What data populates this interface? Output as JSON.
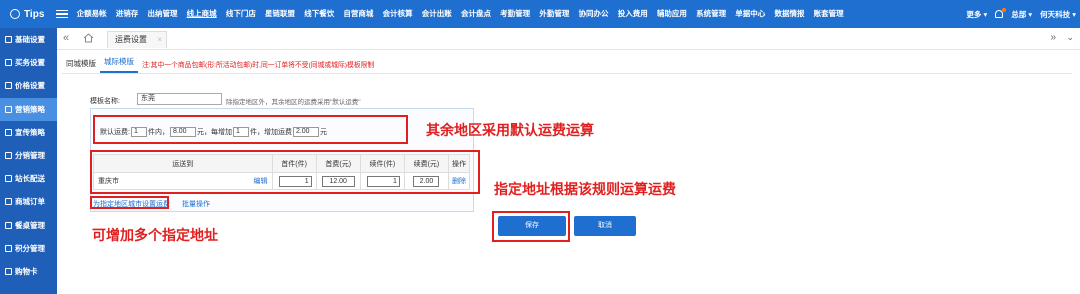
{
  "brand": {
    "name": "Tips"
  },
  "nav": [
    "企额易帐",
    "进销存",
    "出纳管理",
    "线上商城",
    "线下门店",
    "星链联盟",
    "线下餐饮",
    "自营商城",
    "会计核算",
    "会计出账",
    "会计盘点",
    "考勤管理",
    "外勤管理",
    "协同办公",
    "投入费用",
    "辅助应用",
    "系统管理",
    "单据中心",
    "数据情报",
    "账套管理"
  ],
  "top_right": {
    "more": "更多",
    "user": "总部",
    "company": "何天科技"
  },
  "sidebar": [
    "基础设置",
    "买务设置",
    "价格设置",
    "营销策略",
    "宣传策略",
    "分销管理",
    "站长配送",
    "商城订单",
    "餐桌管理",
    "积分管理",
    "购物卡"
  ],
  "page_tab": {
    "label": "运费设置",
    "close": "×"
  },
  "subtabs": {
    "tab1": "同城模版",
    "tab2": "城际模版",
    "note": "注:其中一个商品包邮(形:所活动包邮)时,同一订单将不受(同城或城际)模板限制"
  },
  "form": {
    "name_label": "模板名称:",
    "name_value": "东莞",
    "hint": "除指定地区外，其余地区的运费采用\"默认运费\"",
    "default": {
      "label": "默认运费:",
      "first_qty": "1",
      "unit1": "件内，",
      "first_fee": "8.00",
      "unit2": "元，每增加",
      "add_qty": "1",
      "unit3": "件，增加运费",
      "add_fee": "2.00",
      "unit4": "元"
    },
    "table": {
      "headers": [
        "运送到",
        "首件(件)",
        "首费(元)",
        "续件(件)",
        "续费(元)",
        "操作"
      ],
      "row": {
        "region": "重庆市",
        "edit": "编辑",
        "first_qty": "1",
        "first_fee": "12.00",
        "add_qty": "1",
        "add_fee": "2.00",
        "delete": "删除"
      }
    },
    "links": {
      "add_region": "为指定地区城市设置运费",
      "batch": "批量操作"
    }
  },
  "buttons": {
    "save": "保存",
    "cancel": "取消"
  },
  "annotations": {
    "a1": "其余地区采用默认运费运算",
    "a2": "指定地址根据该规则运算运费",
    "a3": "可增加多个指定地址"
  },
  "colors": {
    "primary": "#1e6fd0",
    "sidebar": "#1f5fb8",
    "highlight": "#e02020"
  }
}
